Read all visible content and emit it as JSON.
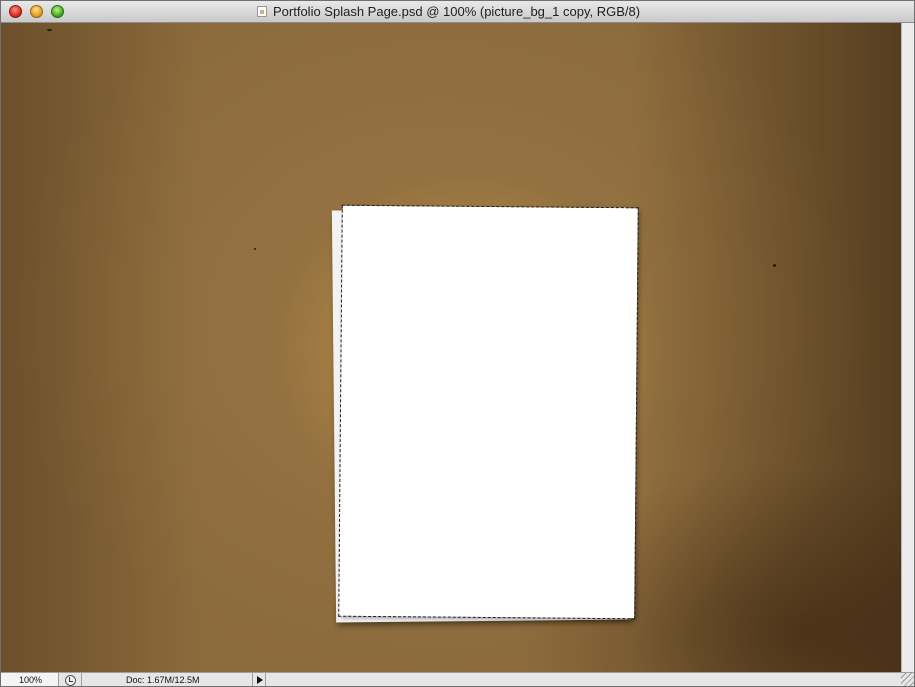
{
  "window": {
    "title": "Portfolio Splash Page.psd @ 100% (picture_bg_1 copy, RGB/8)",
    "controls": [
      "close-icon",
      "minimize-icon",
      "zoom-icon"
    ]
  },
  "canvas": {
    "background_color": "#8b6a3c",
    "glow_color": "#f6c464",
    "paper_color": "#ffffff",
    "selection": "marching-ants"
  },
  "status_bar": {
    "zoom": "100%",
    "doc_size": "Doc: 1.67M/12.5M"
  }
}
